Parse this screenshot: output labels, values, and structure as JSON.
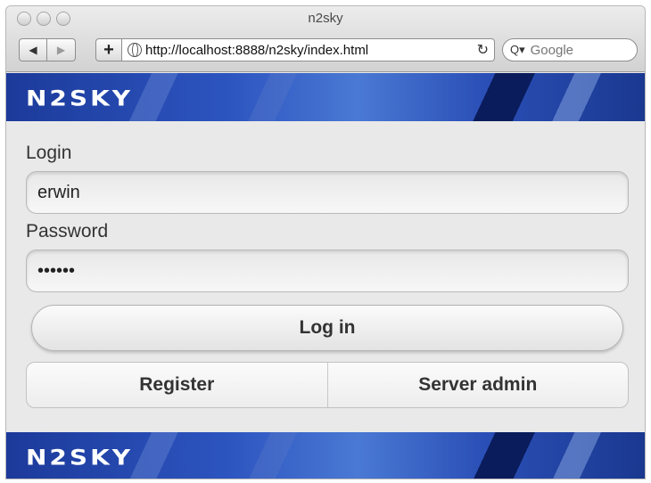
{
  "window": {
    "title": "n2sky"
  },
  "toolbar": {
    "back_icon": "◀",
    "forward_icon": "▶",
    "add_icon": "+",
    "url": "http://localhost:8888/n2sky/index.html",
    "reload_icon": "↻",
    "search_icon": "Q▾",
    "search_placeholder": "Google"
  },
  "header": {
    "logo_text": "n2sky"
  },
  "form": {
    "login_label": "Login",
    "login_value": "erwin",
    "password_label": "Password",
    "password_value": "••••••",
    "login_button": "Log in",
    "register_button": "Register",
    "server_admin_button": "Server admin"
  },
  "footer": {
    "logo_text": "n2sky"
  }
}
